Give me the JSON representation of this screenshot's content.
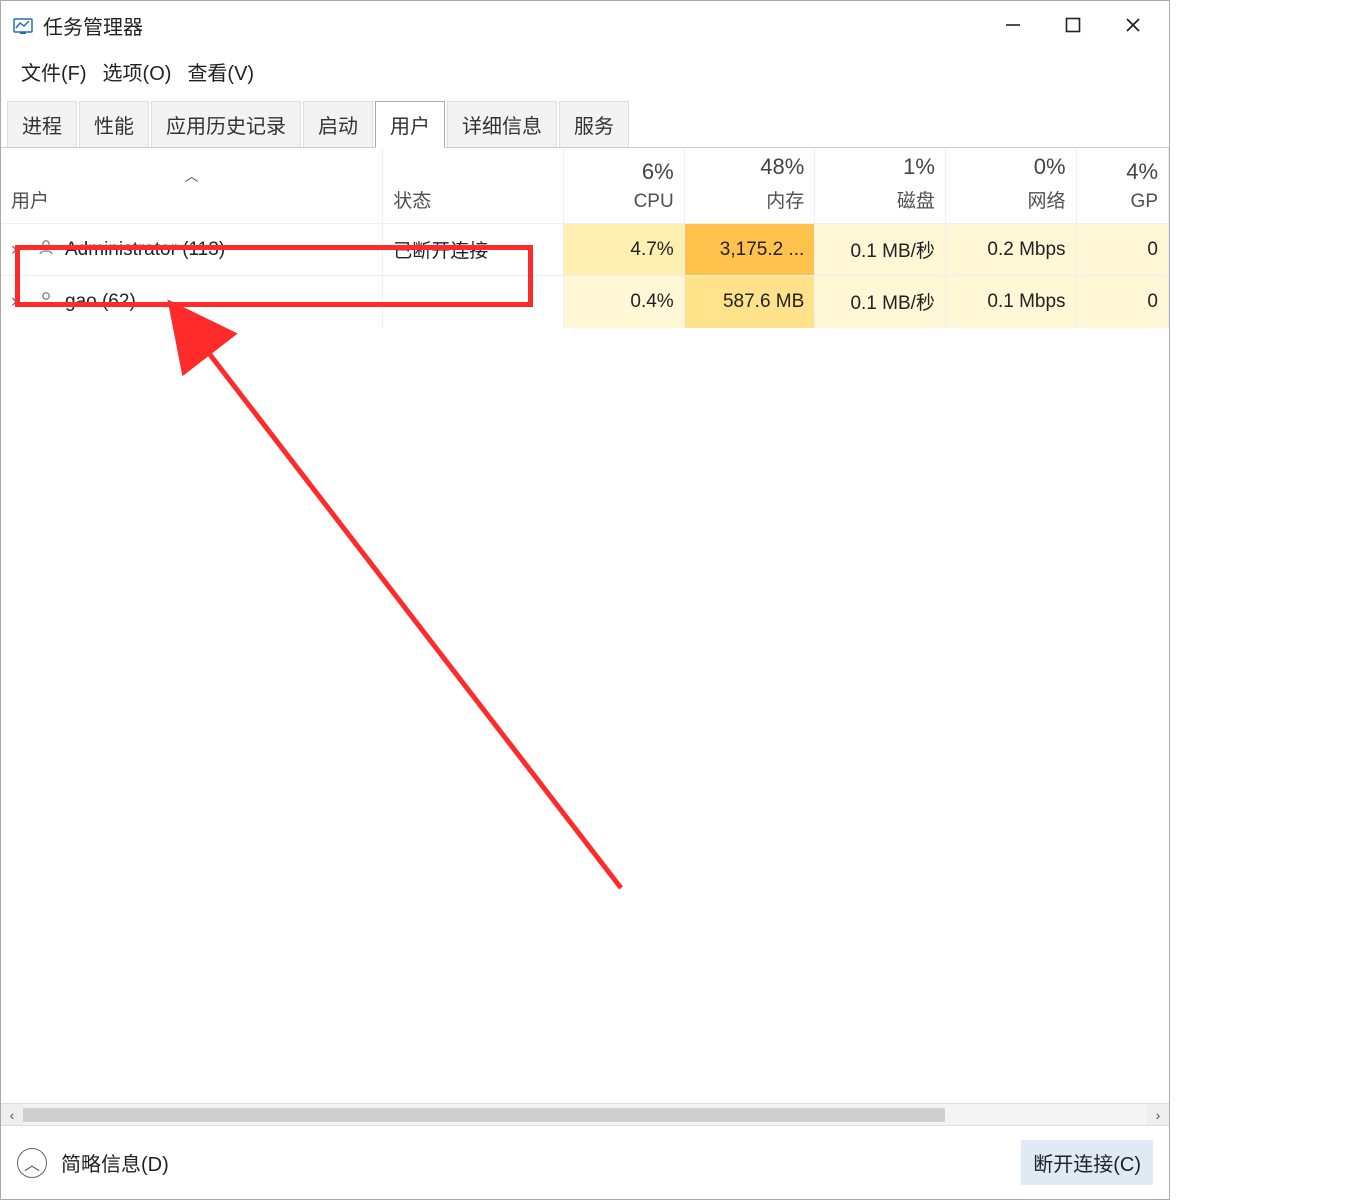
{
  "window": {
    "title": "任务管理器"
  },
  "menu": {
    "file": "文件(F)",
    "options": "选项(O)",
    "view": "查看(V)"
  },
  "tabs": [
    "进程",
    "性能",
    "应用历史记录",
    "启动",
    "用户",
    "详细信息",
    "服务"
  ],
  "active_tab_index": 4,
  "columns": {
    "user": "用户",
    "status": "状态",
    "cpu": {
      "pct": "6%",
      "label": "CPU"
    },
    "mem": {
      "pct": "48%",
      "label": "内存"
    },
    "disk": {
      "pct": "1%",
      "label": "磁盘"
    },
    "net": {
      "pct": "0%",
      "label": "网络"
    },
    "gpu": {
      "pct": "4%",
      "label": "GP"
    }
  },
  "rows": [
    {
      "name": "Administrator (113)",
      "status": "已断开连接",
      "cpu": "4.7%",
      "mem": "3,175.2 ...",
      "disk": "0.1 MB/秒",
      "net": "0.2 Mbps",
      "gpu": "0"
    },
    {
      "name": "gao (62)",
      "status": "",
      "cpu": "0.4%",
      "mem": "587.6 MB",
      "disk": "0.1 MB/秒",
      "net": "0.1 Mbps",
      "gpu": "0"
    }
  ],
  "footer": {
    "brief": "简略信息(D)",
    "disconnect": "断开连接(C)"
  }
}
